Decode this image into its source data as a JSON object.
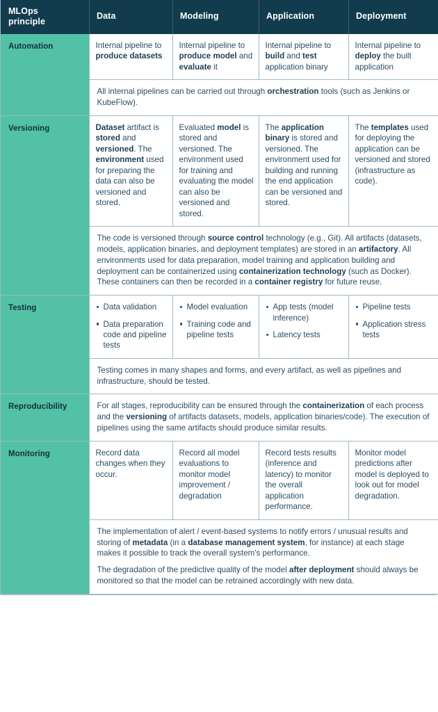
{
  "colors": {
    "header_bg": "#123c4e",
    "principle_bg": "#53c1a6",
    "border": "#9fb9c8",
    "text": "#2a4c64",
    "header_text": "#ffffff"
  },
  "header": {
    "principle": "MLOps\nprinciple",
    "columns": [
      "Data",
      "Modeling",
      "Application",
      "Deployment"
    ]
  },
  "rows": [
    {
      "principle": "Automation",
      "cells": [
        {
          "segments": [
            {
              "t": "Internal pipeline to ",
              "b": false
            },
            {
              "t": "produce datasets",
              "b": true
            }
          ]
        },
        {
          "segments": [
            {
              "t": "Internal pipeline to ",
              "b": false
            },
            {
              "t": "produce model",
              "b": true
            },
            {
              "t": " and ",
              "b": false
            },
            {
              "t": "evaluate",
              "b": true
            },
            {
              "t": " it",
              "b": false
            }
          ]
        },
        {
          "segments": [
            {
              "t": "Internal pipeline to ",
              "b": false
            },
            {
              "t": "build",
              "b": true
            },
            {
              "t": " and ",
              "b": false
            },
            {
              "t": "test",
              "b": true
            },
            {
              "t": " application binary",
              "b": false
            }
          ]
        },
        {
          "segments": [
            {
              "t": "Internal pipeline to ",
              "b": false
            },
            {
              "t": "deploy",
              "b": true
            },
            {
              "t": " the built application",
              "b": false
            }
          ]
        }
      ],
      "summary": [
        {
          "segments": [
            {
              "t": "All internal pipelines can be carried out through ",
              "b": false
            },
            {
              "t": "orchestration",
              "b": true
            },
            {
              "t": " tools (such as Jenkins or KubeFlow).",
              "b": false
            }
          ]
        }
      ]
    },
    {
      "principle": "Versioning",
      "cells": [
        {
          "segments": [
            {
              "t": "Dataset",
              "b": true
            },
            {
              "t": " artifact is ",
              "b": false
            },
            {
              "t": "stored",
              "b": true
            },
            {
              "t": " and ",
              "b": false
            },
            {
              "t": "versioned",
              "b": true
            },
            {
              "t": ". The ",
              "b": false
            },
            {
              "t": "environment",
              "b": true
            },
            {
              "t": " used for preparing the data can also be versioned and stored.",
              "b": false
            }
          ]
        },
        {
          "segments": [
            {
              "t": "Evaluated ",
              "b": false
            },
            {
              "t": "model",
              "b": true
            },
            {
              "t": " is stored and versioned. The environment used for training and evaluating the model can also be versioned and stored.",
              "b": false
            }
          ]
        },
        {
          "segments": [
            {
              "t": "The ",
              "b": false
            },
            {
              "t": "application binary",
              "b": true
            },
            {
              "t": " is stored and versioned. The environment used for building and running the end application can be versioned and stored.",
              "b": false
            }
          ]
        },
        {
          "segments": [
            {
              "t": "The ",
              "b": false
            },
            {
              "t": "templates",
              "b": true
            },
            {
              "t": " used for deploying the application can be versioned and stored (infrastructure as code).",
              "b": false
            }
          ]
        }
      ],
      "summary": [
        {
          "segments": [
            {
              "t": "The code is versioned through ",
              "b": false
            },
            {
              "t": "source control",
              "b": true
            },
            {
              "t": " technology (e.g., Git). All artifacts (datasets, models, application binaries, and deployment templates) are stored in an ",
              "b": false
            },
            {
              "t": "artifactory",
              "b": true
            },
            {
              "t": ". All environments used for data preparation, model training and application building and deployment can be containerized using ",
              "b": false
            },
            {
              "t": "containerization technology",
              "b": true
            },
            {
              "t": " (such as Docker). These containers can then be recorded in a ",
              "b": false
            },
            {
              "t": "container registry",
              "b": true
            },
            {
              "t": " for future reuse.",
              "b": false
            }
          ]
        }
      ]
    },
    {
      "principle": "Testing",
      "bullets": [
        [
          "Data validation",
          "Data preparation code and pipeline tests"
        ],
        [
          "Model evaluation",
          "Training code and pipeline tests"
        ],
        [
          "App tests (model inference)",
          "Latency tests"
        ],
        [
          "Pipeline tests",
          "Application stress tests"
        ]
      ],
      "summary": [
        {
          "segments": [
            {
              "t": "Testing comes in many shapes and forms, and every artifact, as well as pipelines and infrastructure, should be tested.",
              "b": false
            }
          ]
        }
      ]
    },
    {
      "principle": "Reproducibility",
      "summary_only": true,
      "summary": [
        {
          "segments": [
            {
              "t": "For all stages, reproducibility can be ensured through the ",
              "b": false
            },
            {
              "t": "containerization",
              "b": true
            },
            {
              "t": " of each process and the ",
              "b": false
            },
            {
              "t": "versioning",
              "b": true
            },
            {
              "t": " of artifacts datasets, models, application binaries/code). The execution of pipelines using the same artifacts should produce similar results.",
              "b": false
            }
          ]
        }
      ]
    },
    {
      "principle": "Monitoring",
      "cells": [
        {
          "segments": [
            {
              "t": "Record data changes when they occur.",
              "b": false
            }
          ]
        },
        {
          "segments": [
            {
              "t": "Record all model evaluations to monitor model improvement / degradation",
              "b": false
            }
          ]
        },
        {
          "segments": [
            {
              "t": "Record tests results (inference and latency) to monitor the overall application performance.",
              "b": false
            }
          ]
        },
        {
          "segments": [
            {
              "t": "Monitor model predictions after model is deployed to look out for model degradation.",
              "b": false
            }
          ]
        }
      ],
      "summary": [
        {
          "segments": [
            {
              "t": "The implementation of alert / event-based systems to notify errors / unusual results and storing of ",
              "b": false
            },
            {
              "t": "metadata",
              "b": true
            },
            {
              "t": " (in a ",
              "b": false
            },
            {
              "t": "database management system",
              "b": true
            },
            {
              "t": ", for instance) at each stage makes it possible to track the overall system's performance.",
              "b": false
            }
          ]
        },
        {
          "segments": [
            {
              "t": "The degradation of the predictive quality of the model ",
              "b": false
            },
            {
              "t": "after deployment",
              "b": true
            },
            {
              "t": " should always be monitored so that the model can be retrained accordingly with new data.",
              "b": false
            }
          ]
        }
      ]
    }
  ]
}
